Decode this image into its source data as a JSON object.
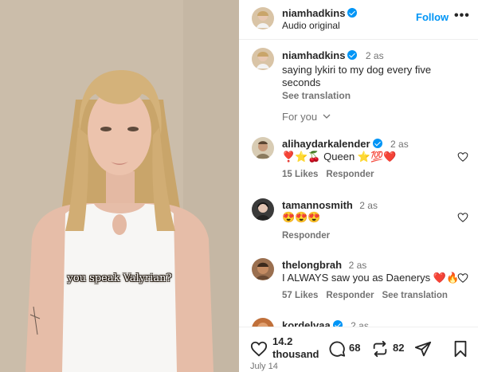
{
  "media": {
    "overlay_text": "you speak Valyrian?"
  },
  "header": {
    "username": "niamhadkins",
    "subtitle": "Audio original",
    "follow_label": "Follow",
    "more_label": "•••"
  },
  "caption": {
    "username": "niamhadkins",
    "time": "2 as",
    "text": "saying lykiri to my dog every five seconds",
    "see_translation": "See translation"
  },
  "for_you": {
    "label": "For you"
  },
  "comments": [
    {
      "username": "alihaydarkalender",
      "verified": true,
      "time": "2 as",
      "text": "❣️⭐🍒 Queen ⭐💯❤️",
      "likes": "15 Likes",
      "reply": "Responder"
    },
    {
      "username": "tamannosmith",
      "verified": false,
      "time": "2 as",
      "text": "😍😍😍",
      "reply": "Responder"
    },
    {
      "username": "thelongbrah",
      "verified": false,
      "time": "2 as",
      "text": "I ALWAYS saw you as Daenerys ❤️🔥",
      "likes": "57 Likes",
      "reply": "Responder",
      "see_translation": "See translation"
    },
    {
      "username": "kordelvaa",
      "verified": true,
      "time": "2 as"
    }
  ],
  "actions": {
    "likes_line1": "14.2",
    "likes_line2": "thousand",
    "comments_count": "68",
    "reposts_count": "82",
    "date": "July 14"
  },
  "icons": [
    "verified-badge-icon",
    "chevron-down-icon",
    "heart-icon",
    "comment-icon",
    "repost-icon",
    "share-icon",
    "bookmark-icon"
  ],
  "colors": {
    "accent": "#0095f6",
    "text": "#262626",
    "muted": "#737373"
  }
}
